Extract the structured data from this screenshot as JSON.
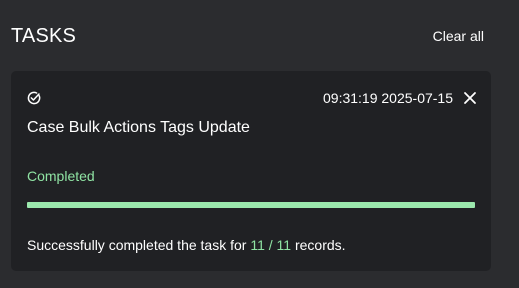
{
  "header": {
    "title": "TASKS",
    "clear_label": "Clear all"
  },
  "task": {
    "status_icon": "check-circle-icon",
    "timestamp": "09:31:19 2025-07-15",
    "close_icon": "close-icon",
    "name": "Case Bulk Actions Tags Update",
    "status": "Completed",
    "progress": 1.0,
    "message_prefix": "Successfully completed the task for",
    "completed": "11",
    "separator": "/",
    "total": "11",
    "message_suffix": "records."
  },
  "colors": {
    "background": "#2b2c2f",
    "card": "#202124",
    "accent_green": "#8fe3a3",
    "progress_fill": "#9be8ad"
  }
}
